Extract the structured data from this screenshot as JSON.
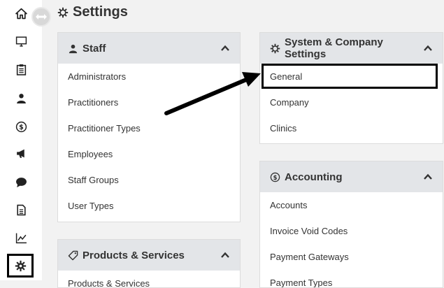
{
  "page": {
    "title": "Settings"
  },
  "sidebar": {
    "items": [
      {
        "name": "home-icon"
      },
      {
        "name": "monitor-icon"
      },
      {
        "name": "clipboard-icon"
      },
      {
        "name": "staff-icon"
      },
      {
        "name": "dollar-icon"
      },
      {
        "name": "megaphone-icon"
      },
      {
        "name": "chat-icon"
      },
      {
        "name": "document-icon"
      },
      {
        "name": "chart-icon"
      },
      {
        "name": "gear-icon",
        "active": true
      }
    ]
  },
  "staff": {
    "title": "Staff",
    "items": [
      "Administrators",
      "Practitioners",
      "Practitioner Types",
      "Employees",
      "Staff Groups",
      "User Types"
    ]
  },
  "products": {
    "title": "Products & Services",
    "items": [
      "Products & Services"
    ]
  },
  "system": {
    "title": "System & Company Settings",
    "items": [
      "General",
      "Company",
      "Clinics"
    ]
  },
  "accounting": {
    "title": "Accounting",
    "items": [
      "Accounts",
      "Invoice Void Codes",
      "Payment Gateways",
      "Payment Types"
    ]
  },
  "colors": {
    "header_bg": "#e3e5e8",
    "page_bg": "#f2f2f2",
    "highlight": "#000000"
  }
}
